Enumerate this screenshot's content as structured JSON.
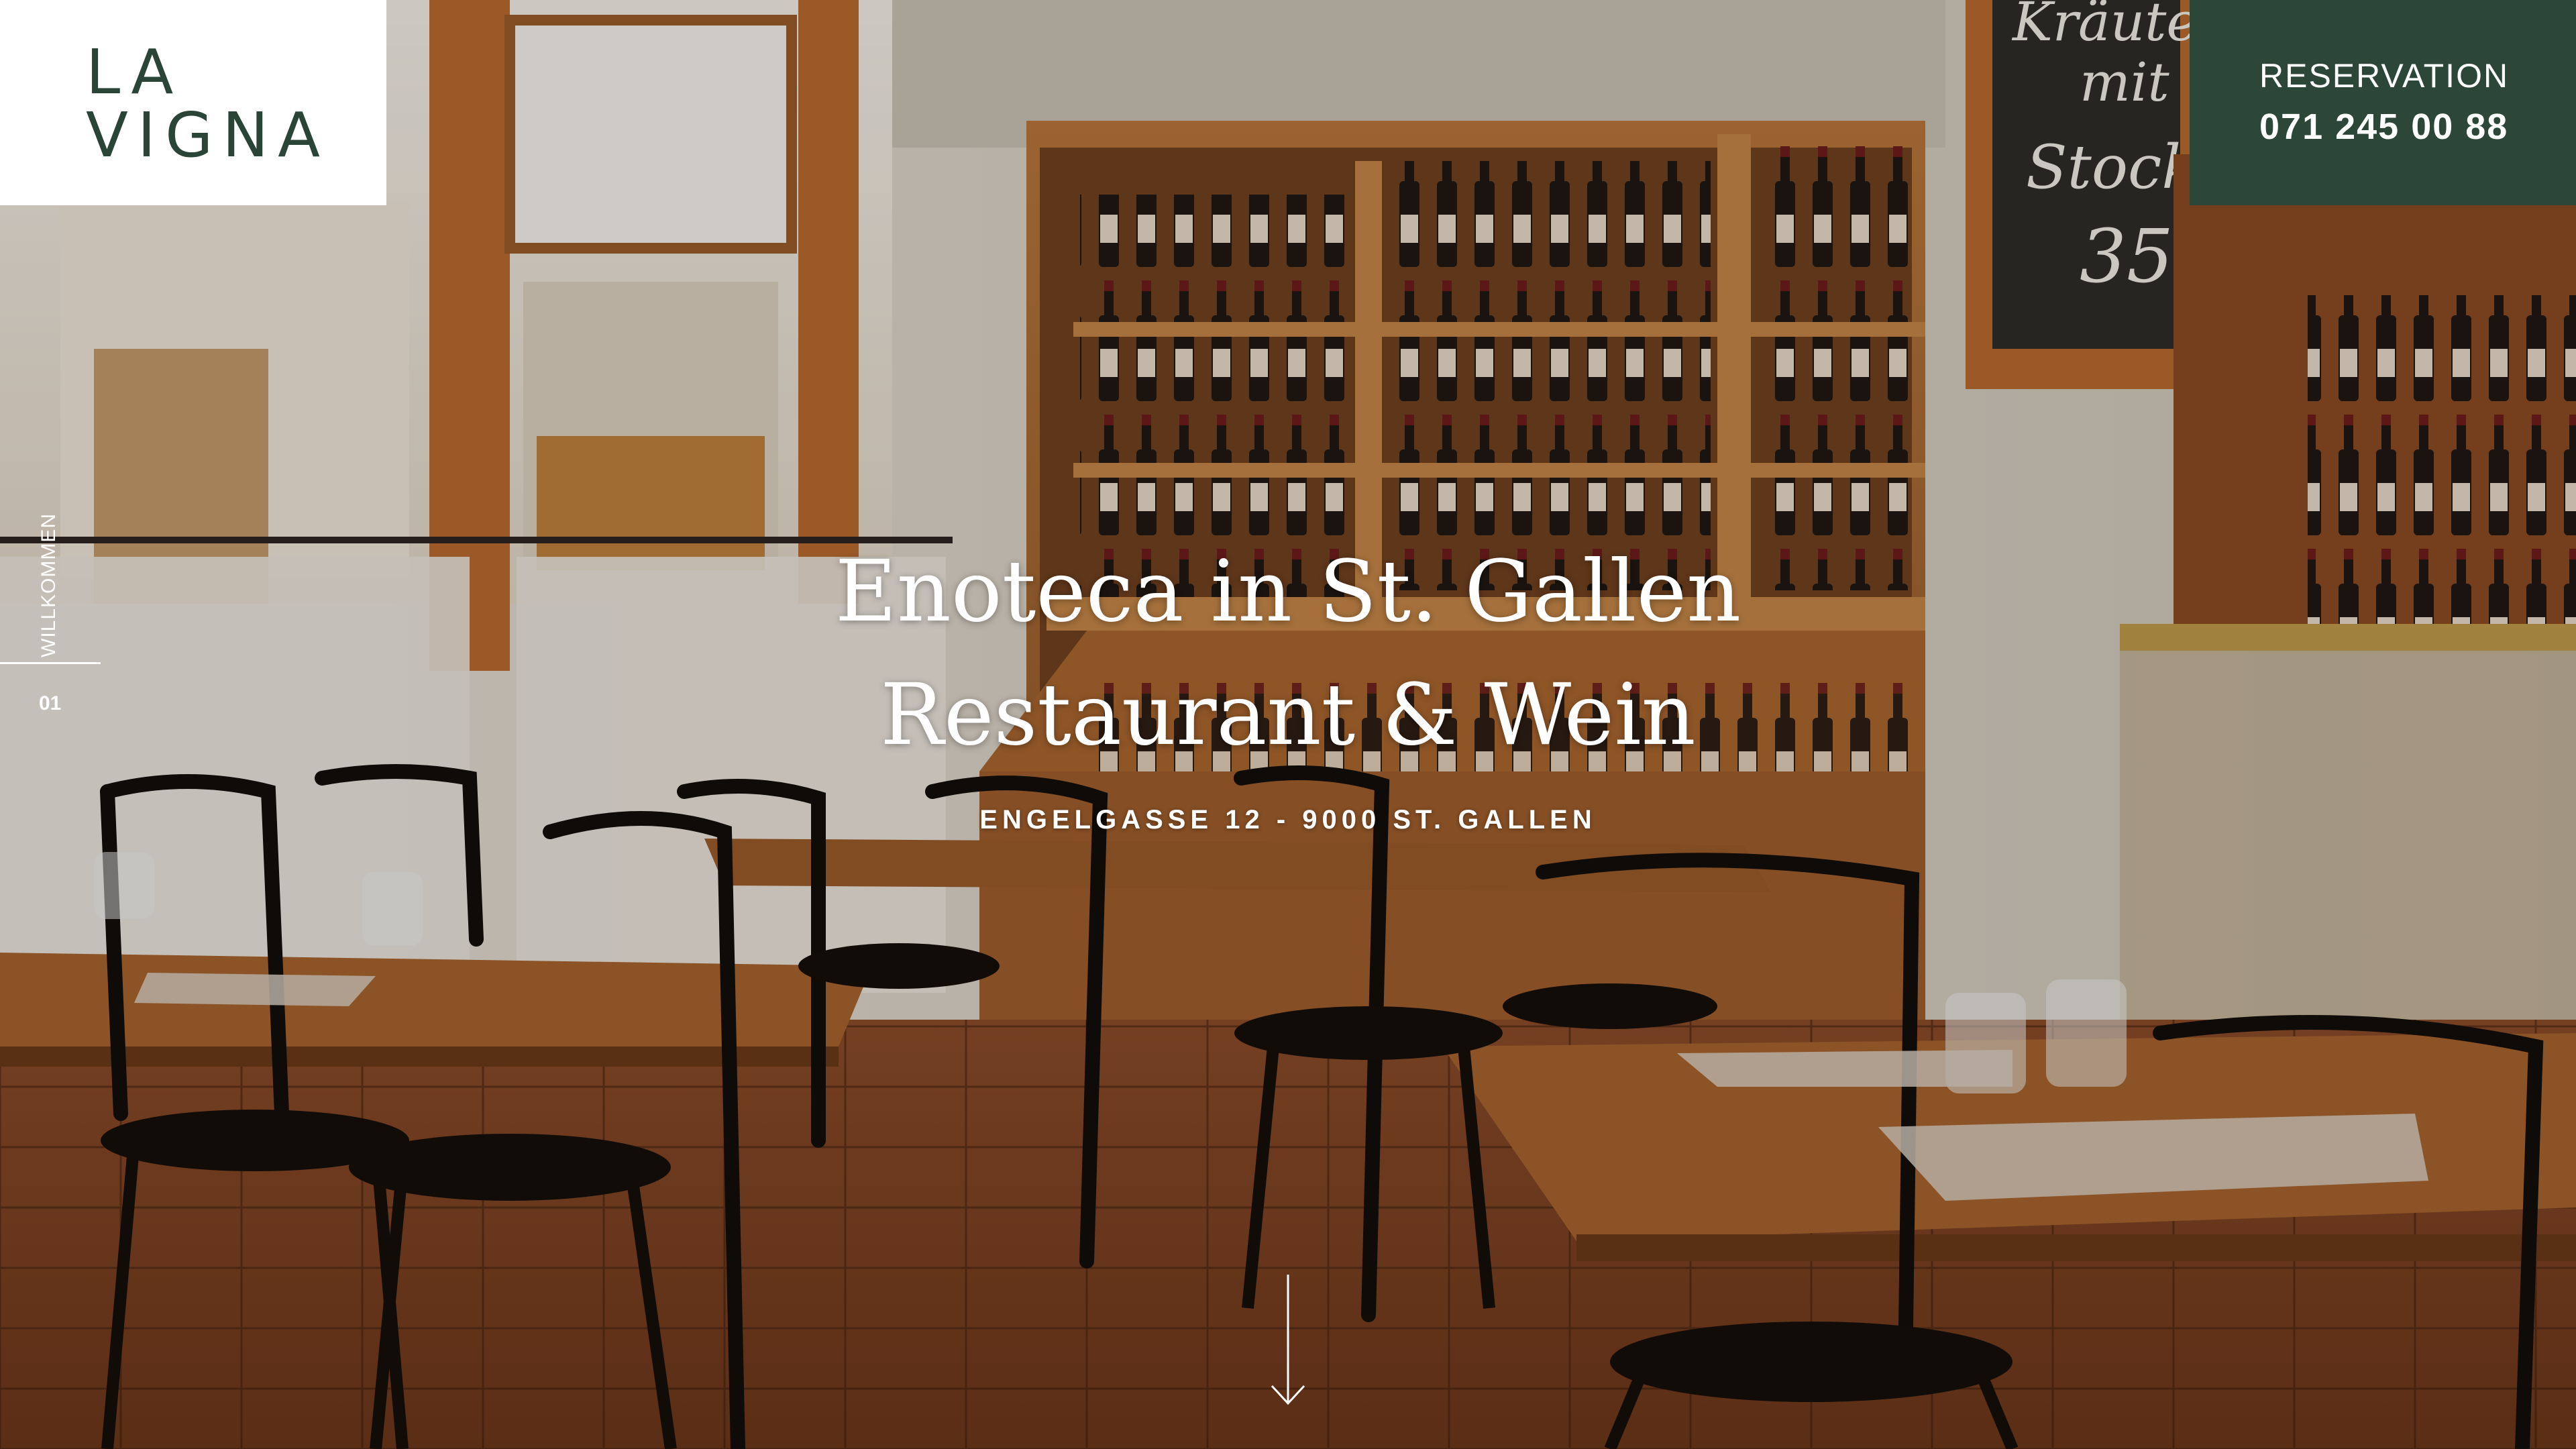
{
  "header": {
    "logo_line1": "LA",
    "logo_line2": "VIGNA"
  },
  "reservation": {
    "label": "RESERVATION",
    "phone": "071 245 00 88"
  },
  "sidenav": {
    "label": "WILLKOMMEN",
    "number": "01"
  },
  "hero": {
    "title_line1": "Enoteca in St. Gallen",
    "title_line2": "Restaurant & Wein",
    "address": "ENGELGASSE 12 - 9000 ST. GALLEN",
    "scroll_icon": "arrow-down-icon"
  },
  "colors": {
    "brand_green": "#2c4737",
    "logo_green": "#2b4438",
    "text_white": "#ffffff"
  }
}
